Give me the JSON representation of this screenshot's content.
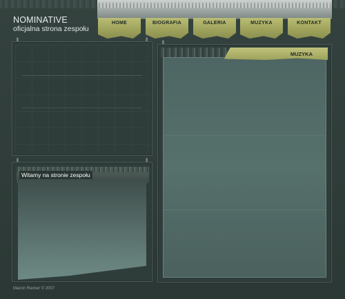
{
  "site": {
    "name": "NOMINATIVE",
    "tagline": "oficjalna strona zespołu"
  },
  "nav": {
    "items": [
      {
        "label": "HOME"
      },
      {
        "label": "BIOGRAFIA"
      },
      {
        "label": "GALERIA"
      },
      {
        "label": "MUZYKA"
      },
      {
        "label": "KONTAKT"
      }
    ]
  },
  "content": {
    "welcome_title": "Witamy na stronie zespołu",
    "section_tab": "MUZYKA"
  },
  "footer": {
    "author": "Marcin Riemer",
    "copyright": "© 2007"
  },
  "colors": {
    "background": "#2f3d3a",
    "accent": "#b9bd74",
    "panel": "#56706c"
  }
}
